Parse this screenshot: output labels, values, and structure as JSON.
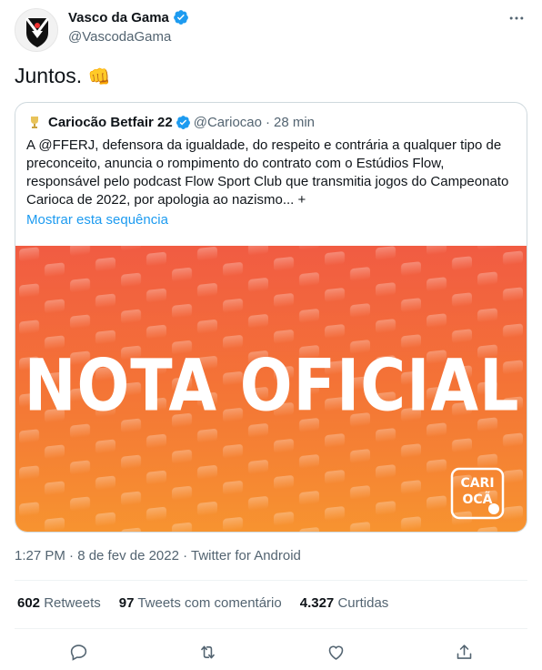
{
  "author": {
    "display_name": "Vasco da Gama",
    "handle": "@VascodaGama"
  },
  "tweet": {
    "text": "Juntos.",
    "emoji": "👊"
  },
  "quoted": {
    "display_name": "Cariocão Betfair 22",
    "handle": "@Cariocao",
    "separator": "·",
    "time": "28 min",
    "body": "A @FFERJ, defensora da igualdade, do respeito e contrária a qualquer tipo de preconceito, anuncia o rompimento do contrato com o  Estúdios Flow, responsável pelo podcast Flow Sport Club que transmitia jogos do Campeonato Carioca de 2022, por apologia ao nazismo... +",
    "show_thread": "Mostrar esta sequência",
    "media": {
      "headline": "NOTA OFICIAL",
      "logo_text": "CARIOCA"
    }
  },
  "timestamp": "1:27 PM · 8 de fev de 2022 · Twitter for Android",
  "stats": [
    {
      "count": "602",
      "label": "Retweets"
    },
    {
      "count": "97",
      "label": "Tweets com comentário"
    },
    {
      "count": "4.327",
      "label": "Curtidas"
    }
  ],
  "colors": {
    "verified_blue": "#1d9bf0",
    "link_blue": "#1d9bf0",
    "secondary_text": "#536471",
    "media_orange_top": "#f04a2e",
    "media_orange_bottom": "#f79430"
  },
  "icons": [
    "more-icon",
    "verified-icon",
    "reply-icon",
    "retweet-icon",
    "like-icon",
    "share-icon"
  ]
}
